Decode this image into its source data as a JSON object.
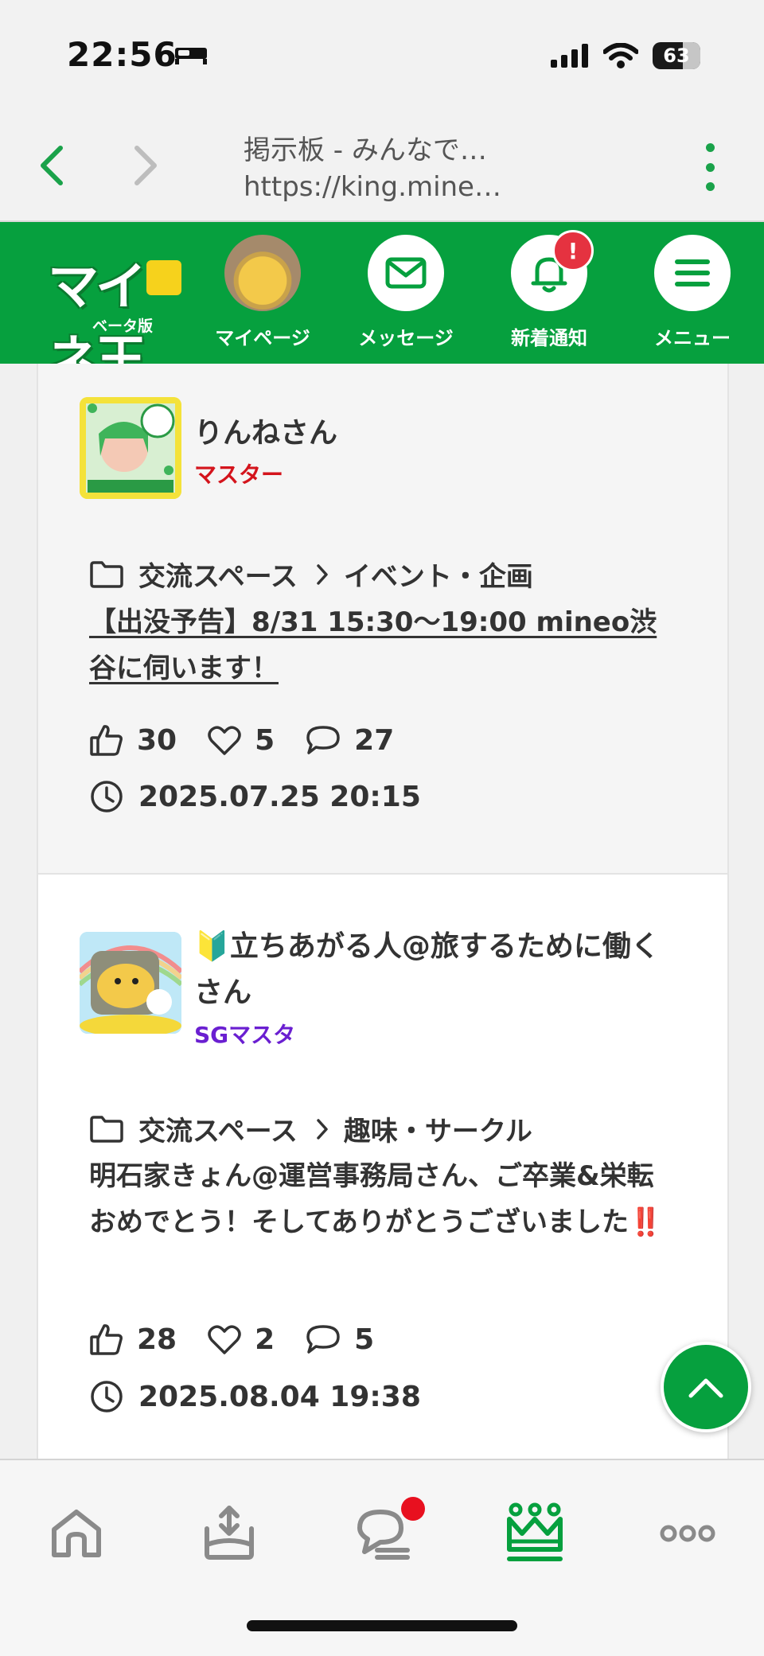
{
  "status": {
    "time": "22:56",
    "battery": "63"
  },
  "browser": {
    "title": "掲示板 - みんなで…",
    "url": "https://king.mine…"
  },
  "header": {
    "logo_text": "マイネ王",
    "logo_sub": "ベータ版",
    "nav": [
      {
        "label": "マイページ",
        "icon": "avatar"
      },
      {
        "label": "メッセージ",
        "icon": "envelope-icon"
      },
      {
        "label": "新着通知",
        "icon": "bell-icon",
        "badge": "!"
      },
      {
        "label": "メニュー",
        "icon": "hamburger-icon"
      }
    ]
  },
  "posts": [
    {
      "user": "りんねさん",
      "rank": "マスター",
      "rank_color": "#d4141c",
      "category": "交流スペース",
      "subcategory": "イベント・企画",
      "title": "【出没予告】8/31 15:30〜19:00 mineo渋谷に伺います！",
      "likes": "30",
      "hearts": "5",
      "comments": "27",
      "date": "2025.07.25 20:15"
    },
    {
      "user": "🔰立ちあがる人@旅するために働くさん",
      "rank": "SGマスタ",
      "rank_color": "#6a1fd1",
      "category": "交流スペース",
      "subcategory": "趣味・サークル",
      "title": "明石家きょん@運営事務局さん、ご卒業&栄転おめでとう！そしてありがとうございました‼️",
      "likes": "28",
      "hearts": "2",
      "comments": "5",
      "date": "2025.08.04 19:38"
    }
  ],
  "tabbar": [
    "home-icon",
    "upload-icon",
    "chat-icon",
    "crown-icon",
    "more-icon"
  ],
  "colors": {
    "brand": "#06a03e",
    "badge": "#e53240"
  }
}
